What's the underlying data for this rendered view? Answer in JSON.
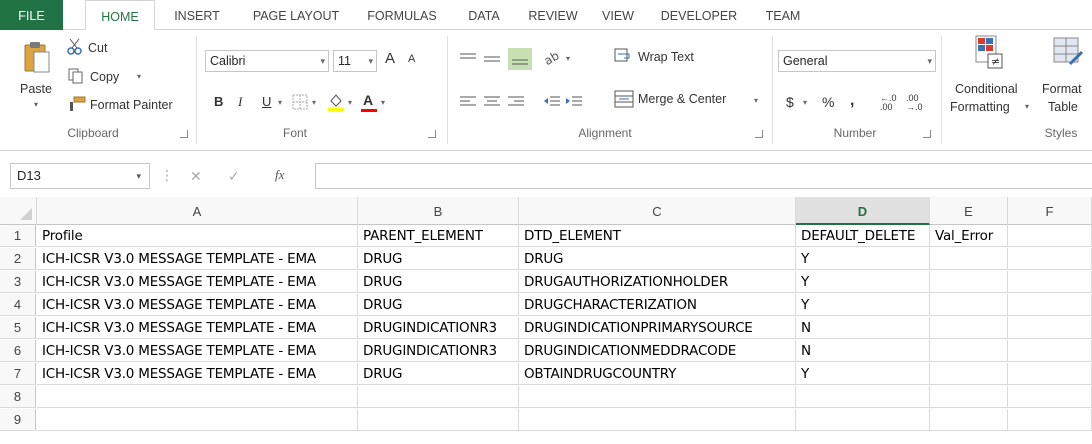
{
  "tabs": [
    "FILE",
    "HOME",
    "INSERT",
    "PAGE LAYOUT",
    "FORMULAS",
    "DATA",
    "REVIEW",
    "VIEW",
    "DEVELOPER",
    "TEAM"
  ],
  "clipboard": {
    "paste": "Paste",
    "cut": "Cut",
    "copy": "Copy",
    "format_painter": "Format Painter",
    "label": "Clipboard"
  },
  "font": {
    "name": "Calibri",
    "size": "11",
    "grow": "A",
    "shrink": "A",
    "bold": "B",
    "italic": "I",
    "underline": "U",
    "font_color": "A",
    "label": "Font"
  },
  "alignment": {
    "wrap_text": "Wrap Text",
    "merge_center": "Merge & Center",
    "label": "Alignment"
  },
  "number": {
    "format": "General",
    "currency": "$",
    "percent": "%",
    "comma": ",",
    "inc_decimal": "←.0 .00",
    "dec_decimal": ".00 →.0",
    "label": "Number"
  },
  "styles": {
    "conditional_formatting_1": "Conditional",
    "conditional_formatting_2": "Formatting",
    "format_table_1": "Format",
    "format_table_2": "Table",
    "label": "Styles"
  },
  "formula_bar": {
    "name_box": "D13",
    "cancel": "✕",
    "enter": "✓",
    "fx": "fx",
    "content": ""
  },
  "columns": [
    "A",
    "B",
    "C",
    "D",
    "E",
    "F"
  ],
  "selected_column": "D",
  "rows": [
    {
      "num": "1",
      "cells": [
        "Profile",
        "PARENT_ELEMENT",
        "DTD_ELEMENT",
        "DEFAULT_DELETE",
        "Val_Error",
        ""
      ]
    },
    {
      "num": "2",
      "cells": [
        "ICH-ICSR V3.0 MESSAGE TEMPLATE - EMA",
        "DRUG",
        "DRUG",
        "Y",
        "",
        ""
      ]
    },
    {
      "num": "3",
      "cells": [
        "ICH-ICSR V3.0 MESSAGE TEMPLATE - EMA",
        "DRUG",
        "DRUGAUTHORIZATIONHOLDER",
        "Y",
        "",
        ""
      ]
    },
    {
      "num": "4",
      "cells": [
        "ICH-ICSR V3.0 MESSAGE TEMPLATE - EMA",
        "DRUG",
        "DRUGCHARACTERIZATION",
        "Y",
        "",
        ""
      ]
    },
    {
      "num": "5",
      "cells": [
        "ICH-ICSR V3.0 MESSAGE TEMPLATE - EMA",
        "DRUGINDICATIONR3",
        "DRUGINDICATIONPRIMARYSOURCE",
        "N",
        "",
        ""
      ]
    },
    {
      "num": "6",
      "cells": [
        "ICH-ICSR V3.0 MESSAGE TEMPLATE - EMA",
        "DRUGINDICATIONR3",
        "DRUGINDICATIONMEDDRACODE",
        "N",
        "",
        ""
      ]
    },
    {
      "num": "7",
      "cells": [
        "ICH-ICSR V3.0 MESSAGE TEMPLATE - EMA",
        "DRUG",
        "OBTAINDRUGCOUNTRY",
        "Y",
        "",
        ""
      ]
    },
    {
      "num": "8",
      "cells": [
        "",
        "",
        "",
        "",
        "",
        ""
      ]
    },
    {
      "num": "9",
      "cells": [
        "",
        "",
        "",
        "",
        "",
        ""
      ]
    }
  ],
  "colors": {
    "accent": "#217346",
    "header_bg": "#f8f8f8",
    "selected_header_bg": "#e1e1e1",
    "gridline": "#dadada"
  }
}
